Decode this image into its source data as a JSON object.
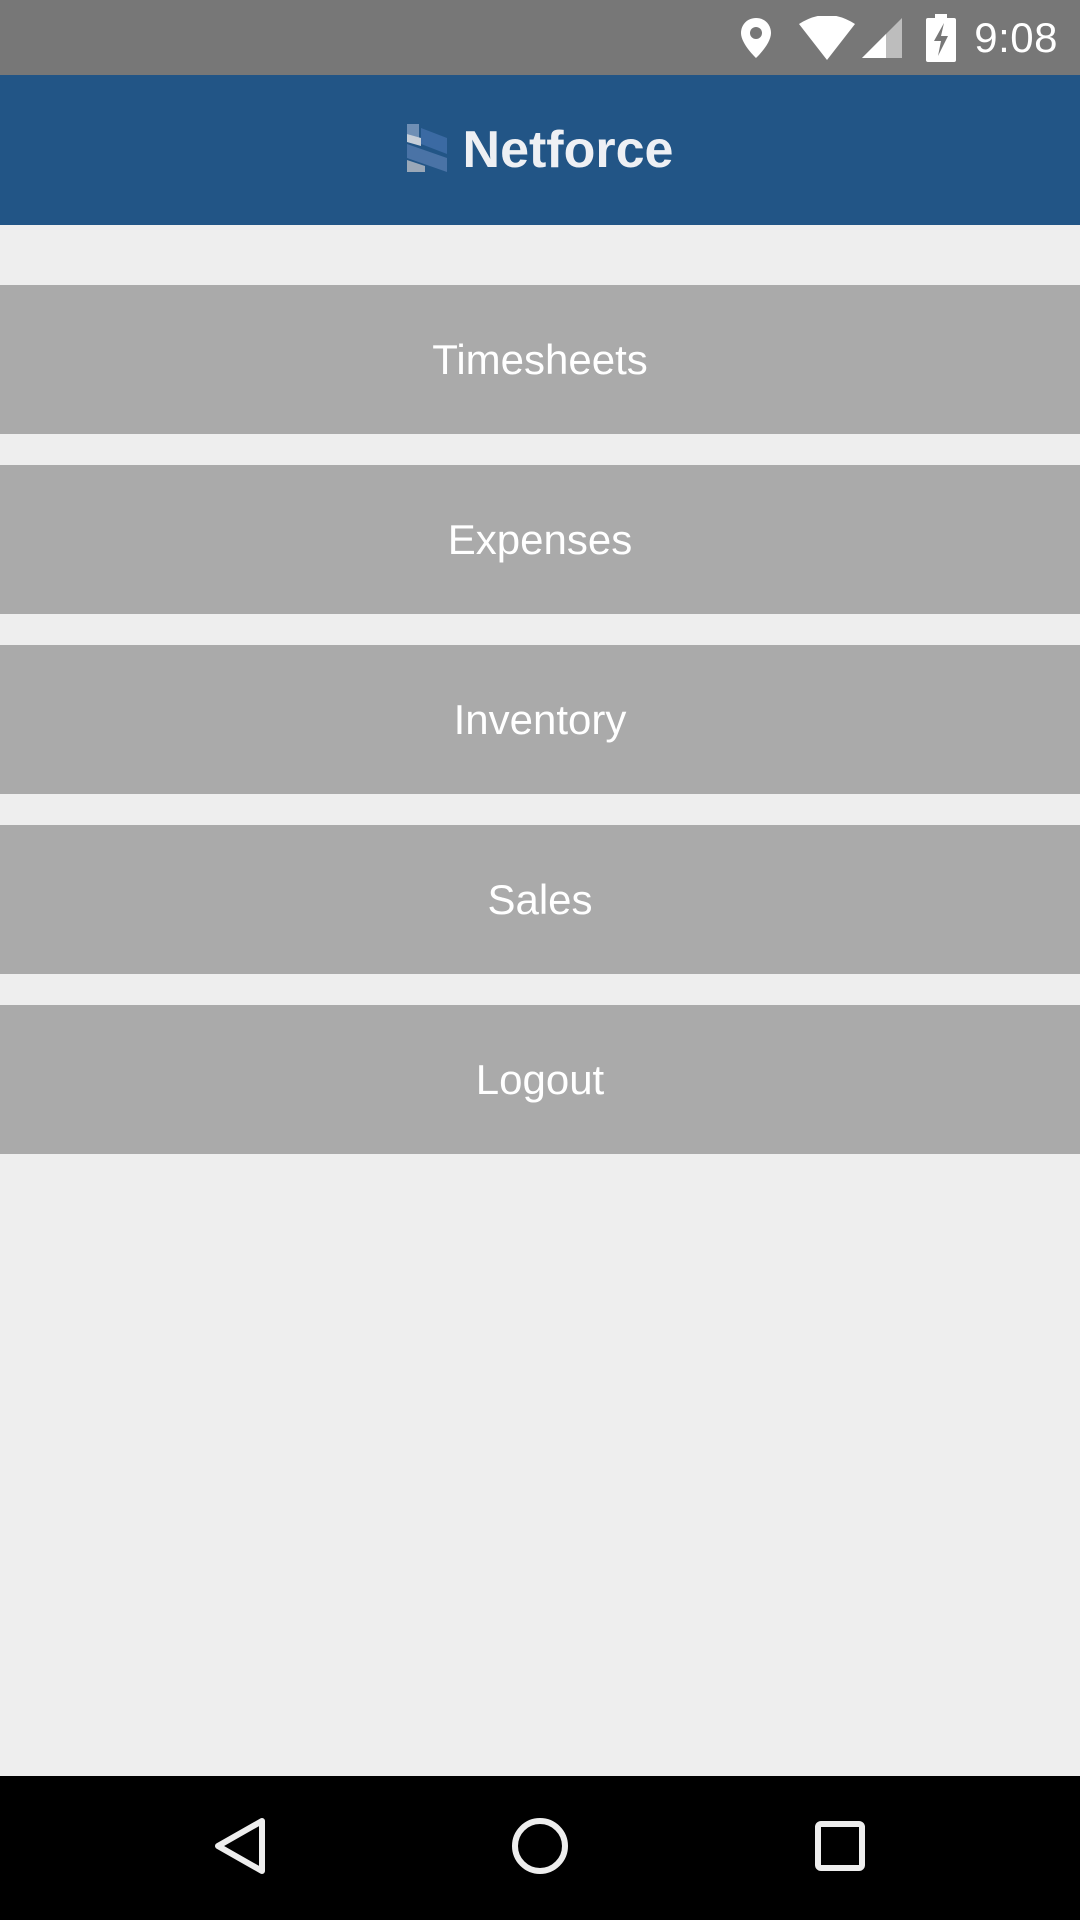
{
  "status_bar": {
    "time": "9:08",
    "icons": [
      "location-icon",
      "wifi-icon",
      "cell-signal-icon",
      "battery-charging-icon"
    ]
  },
  "app_bar": {
    "logo": "netforce-logo-icon",
    "title": "Netforce",
    "color": "#225586"
  },
  "menu": {
    "items": [
      {
        "label": "Timesheets"
      },
      {
        "label": "Expenses"
      },
      {
        "label": "Inventory"
      },
      {
        "label": "Sales"
      },
      {
        "label": "Logout"
      }
    ]
  },
  "nav_bar": {
    "icons": [
      "back-icon",
      "home-icon",
      "recents-icon"
    ]
  }
}
